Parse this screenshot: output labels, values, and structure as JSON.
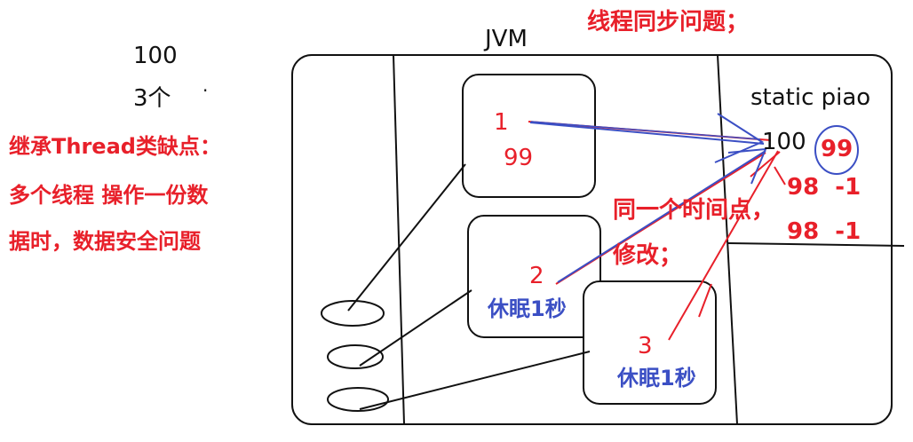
{
  "left_notes": {
    "count": "100",
    "threads": "3个",
    "dot": "·",
    "drawback_line1": "继承Thread类缺点：",
    "drawback_line2": "多个线程 操作一份数",
    "drawback_line3": "据时，数据安全问题"
  },
  "header": {
    "jvm_label": "JVM",
    "sync_title": "线程同步问题；"
  },
  "threads": [
    {
      "id": "1",
      "value": "99",
      "note": ""
    },
    {
      "id": "2",
      "value": "",
      "note": "休眠1秒"
    },
    {
      "id": "3",
      "value": "",
      "note": "休眠1秒"
    }
  ],
  "shared": {
    "static_label": "static piao",
    "initial_value": "100",
    "circled_value": "99",
    "step1": "98  -1",
    "step2": "98  -1"
  },
  "annotation": {
    "line1": "同一个时间点，",
    "line2": "修改；"
  },
  "colors": {
    "red": "#e8202a",
    "blue": "#3b4fc4",
    "black": "#111111"
  }
}
